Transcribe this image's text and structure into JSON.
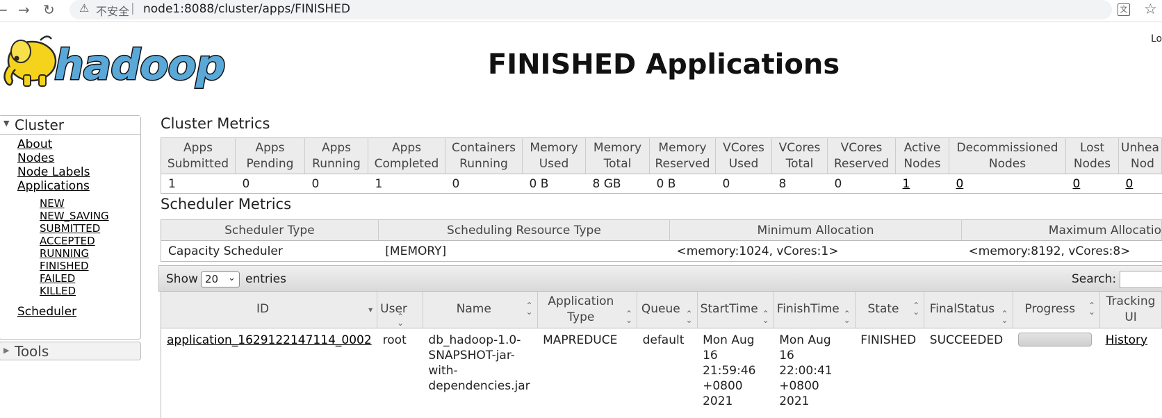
{
  "browser": {
    "back_icon": "arrow-left-icon",
    "forward_icon": "arrow-right-icon",
    "reload_icon": "reload-icon",
    "warning_icon": "warning-icon",
    "insecure_label": "不安全",
    "url": "node1:8088/cluster/apps/FINISHED"
  },
  "header": {
    "logo_text": "hadoop",
    "title": "FINISHED Applications",
    "login_text": "Lo"
  },
  "sidebar": {
    "cluster_label": "Cluster",
    "links": [
      "About",
      "Nodes",
      "Node Labels",
      "Applications"
    ],
    "app_states": [
      "NEW",
      "NEW_SAVING",
      "SUBMITTED",
      "ACCEPTED",
      "RUNNING",
      "FINISHED",
      "FAILED",
      "KILLED"
    ],
    "scheduler_label": "Scheduler",
    "tools_label": "Tools"
  },
  "cluster_metrics": {
    "title": "Cluster Metrics",
    "headers": [
      [
        "Apps",
        "Submitted"
      ],
      [
        "Apps",
        "Pending"
      ],
      [
        "Apps",
        "Running"
      ],
      [
        "Apps",
        "Completed"
      ],
      [
        "Containers",
        "Running"
      ],
      [
        "Memory",
        "Used"
      ],
      [
        "Memory",
        "Total"
      ],
      [
        "Memory",
        "Reserved"
      ],
      [
        "VCores",
        "Used"
      ],
      [
        "VCores",
        "Total"
      ],
      [
        "VCores",
        "Reserved"
      ],
      [
        "Active",
        "Nodes"
      ],
      [
        "Decommissioned",
        "Nodes"
      ],
      [
        "Lost",
        "Nodes"
      ],
      [
        "Unhea",
        "Nod"
      ]
    ],
    "values": [
      "1",
      "0",
      "0",
      "1",
      "0",
      "0 B",
      "8 GB",
      "0 B",
      "0",
      "8",
      "0",
      "1",
      "0",
      "0",
      "0"
    ]
  },
  "scheduler_metrics": {
    "title": "Scheduler Metrics",
    "headers": [
      "Scheduler Type",
      "Scheduling Resource Type",
      "Minimum Allocation",
      "Maximum Allocatio"
    ],
    "values": [
      "Capacity Scheduler",
      "[MEMORY]",
      "<memory:1024, vCores:1>",
      "<memory:8192, vCores:8>"
    ]
  },
  "apps_table": {
    "show_label": "Show",
    "page_size": "20",
    "entries_label": "entries",
    "search_label": "Search:",
    "headers": [
      [
        "ID"
      ],
      [
        "User"
      ],
      [
        "Name"
      ],
      [
        "Application",
        "Type"
      ],
      [
        "Queue"
      ],
      [
        "StartTime"
      ],
      [
        "FinishTime"
      ],
      [
        "State"
      ],
      [
        "FinalStatus"
      ],
      [
        "Progress"
      ],
      [
        "Tracking",
        "UI"
      ]
    ],
    "rows": [
      {
        "id": "application_1629122147114_0002",
        "user": "root",
        "name_lines": [
          "db_hadoop-1.0-",
          "SNAPSHOT-jar-",
          "with-",
          "dependencies.jar"
        ],
        "type": "MAPREDUCE",
        "queue": "default",
        "start_lines": [
          "Mon Aug",
          "16",
          "21:59:46",
          "+0800",
          "2021"
        ],
        "finish_lines": [
          "Mon Aug",
          "16 22:00:41",
          "+0800",
          "2021"
        ],
        "state": "FINISHED",
        "final_status": "SUCCEEDED",
        "progress": 100,
        "tracking": "History"
      }
    ]
  },
  "colors": {
    "header_bg": "#ececec",
    "border": "#bbbbbb",
    "logo_yellow": "#f5d31c",
    "logo_blue": "#5aa8d8"
  }
}
